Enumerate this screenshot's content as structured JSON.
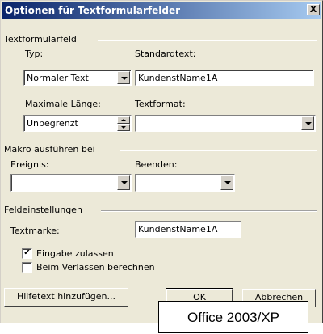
{
  "window": {
    "title": "Optionen für Textformularfelder",
    "close_label": "X"
  },
  "group_textformularfeld": {
    "label": "Textformularfeld",
    "typ_label": "Typ:",
    "typ_value": "Normaler Text",
    "standardtext_label": "Standardtext:",
    "standardtext_value": "KundenstName1A",
    "maxlaenge_label": "Maximale Länge:",
    "maxlaenge_value": "Unbegrenzt",
    "textformat_label": "Textformat:",
    "textformat_value": ""
  },
  "group_makro": {
    "label": "Makro ausführen bei",
    "ereignis_label": "Ereignis:",
    "ereignis_value": "",
    "beenden_label": "Beenden:",
    "beenden_value": ""
  },
  "group_feldeinstellungen": {
    "label": "Feldeinstellungen",
    "textmarke_label": "Textmarke:",
    "textmarke_value": "KundenstName1A",
    "eingabe_label": "Eingabe zulassen",
    "eingabe_checked": true,
    "berechnen_label": "Beim Verlassen berechnen",
    "berechnen_checked": false
  },
  "buttons": {
    "hilfetext": "Hilfetext hinzufügen...",
    "ok": "OK",
    "abbrechen": "Abbrechen"
  },
  "caption": "Office 2003/XP"
}
